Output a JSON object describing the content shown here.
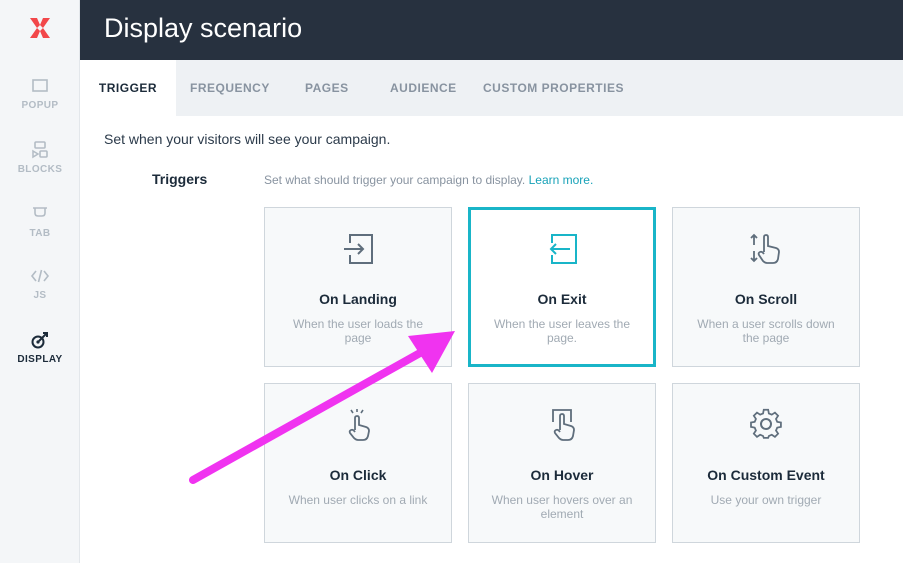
{
  "sidebar": {
    "items": [
      {
        "label": "POPUP",
        "icon": "popup-icon"
      },
      {
        "label": "BLOCKS",
        "icon": "blocks-icon"
      },
      {
        "label": "TAB",
        "icon": "tab-icon"
      },
      {
        "label": "JS",
        "icon": "code-icon"
      },
      {
        "label": "DISPLAY",
        "icon": "display-target-icon",
        "active": true
      }
    ]
  },
  "header": {
    "title": "Display scenario"
  },
  "tabs": [
    {
      "label": "TRIGGER",
      "active": true
    },
    {
      "label": "FREQUENCY"
    },
    {
      "label": "PAGES"
    },
    {
      "label": "AUDIENCE"
    },
    {
      "label": "CUSTOM PROPERTIES"
    }
  ],
  "main": {
    "intro": "Set when your visitors will see your campaign.",
    "section_label": "Triggers",
    "hint": "Set what should trigger your campaign to display.",
    "learn_more": "Learn more.",
    "cards": [
      {
        "title": "On Landing",
        "desc": "When the user loads the page",
        "icon": "enter-icon"
      },
      {
        "title": "On Exit",
        "desc": "When the user leaves the page.",
        "icon": "exit-icon",
        "selected": true
      },
      {
        "title": "On Scroll",
        "desc": "When a user scrolls down the page",
        "icon": "scroll-hand-icon"
      },
      {
        "title": "On Click",
        "desc": "When user clicks on a link",
        "icon": "click-hand-icon"
      },
      {
        "title": "On Hover",
        "desc": "When user hovers over an element",
        "icon": "hover-hand-icon"
      },
      {
        "title": "On Custom Event",
        "desc": "Use your own trigger",
        "icon": "gear-icon"
      }
    ]
  },
  "colors": {
    "header_bg": "#27313f",
    "accent": "#19b5c8",
    "annotation_arrow": "#f033f0",
    "logo": "#f2474a"
  }
}
